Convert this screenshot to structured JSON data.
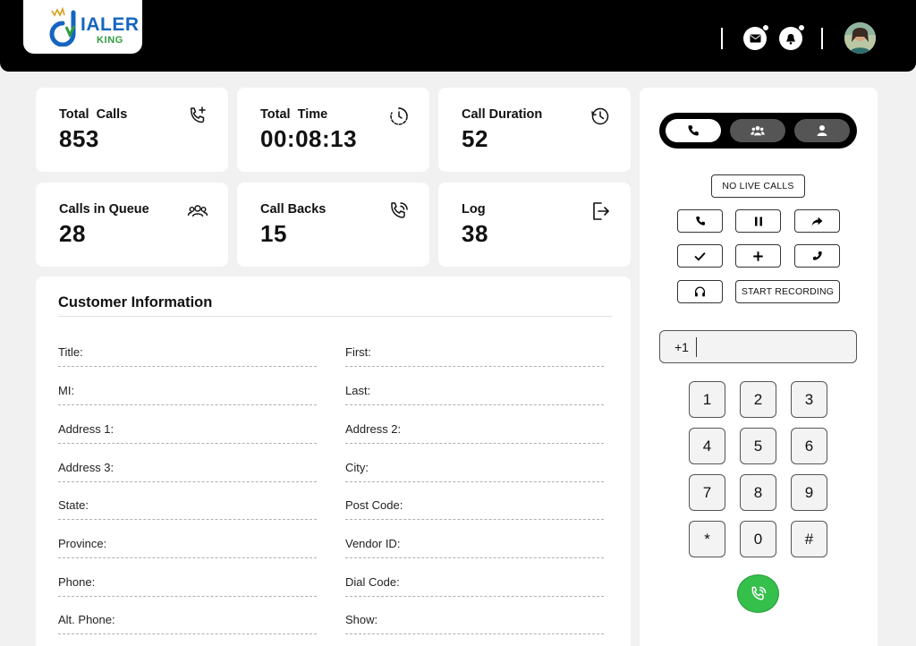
{
  "app": {
    "logo_text_main": "IALER",
    "logo_text_sub": "KING"
  },
  "header": {
    "icons": [
      "mail-icon",
      "bell-icon"
    ],
    "avatar": "user-avatar"
  },
  "stats": [
    {
      "label": "Total  Calls",
      "value": "853",
      "icon": "phone-plus-icon"
    },
    {
      "label": "Total  Time",
      "value": "00:08:13",
      "icon": "clock-icon"
    },
    {
      "label": "Call Duration",
      "value": "52",
      "icon": "history-icon"
    },
    {
      "label": "Calls in Queue",
      "value": "28",
      "icon": "users-icon"
    },
    {
      "label": "Call Backs",
      "value": "15",
      "icon": "phone-callback-icon"
    },
    {
      "label": "Log",
      "value": "38",
      "icon": "logout-icon"
    }
  ],
  "customer_info": {
    "title": "Customer Information",
    "fields_left": [
      "Title:",
      "MI:",
      "Address 1:",
      "Address 3:",
      "State:",
      "Province:",
      "Phone:",
      "Alt. Phone:"
    ],
    "fields_right": [
      "First:",
      "Last:",
      "Address 2:",
      "City:",
      "Post Code:",
      "Vendor ID:",
      "Dial Code:",
      "Show:"
    ]
  },
  "dialer": {
    "tabs": [
      "phone-icon",
      "group-icon",
      "person-icon"
    ],
    "no_live_calls": "NO LIVE CALLS",
    "start_recording": "START RECORDING",
    "phone_prefix": "+1",
    "phone_value": "",
    "keypad": [
      "1",
      "2",
      "3",
      "4",
      "5",
      "6",
      "7",
      "8",
      "9",
      "*",
      "0",
      "#"
    ]
  },
  "colors": {
    "header_bg": "#000000",
    "page_bg": "#f1f1f1",
    "call_green": "#34c04a",
    "logo_blue": "#1565c0",
    "logo_green": "#2e9e3d"
  }
}
